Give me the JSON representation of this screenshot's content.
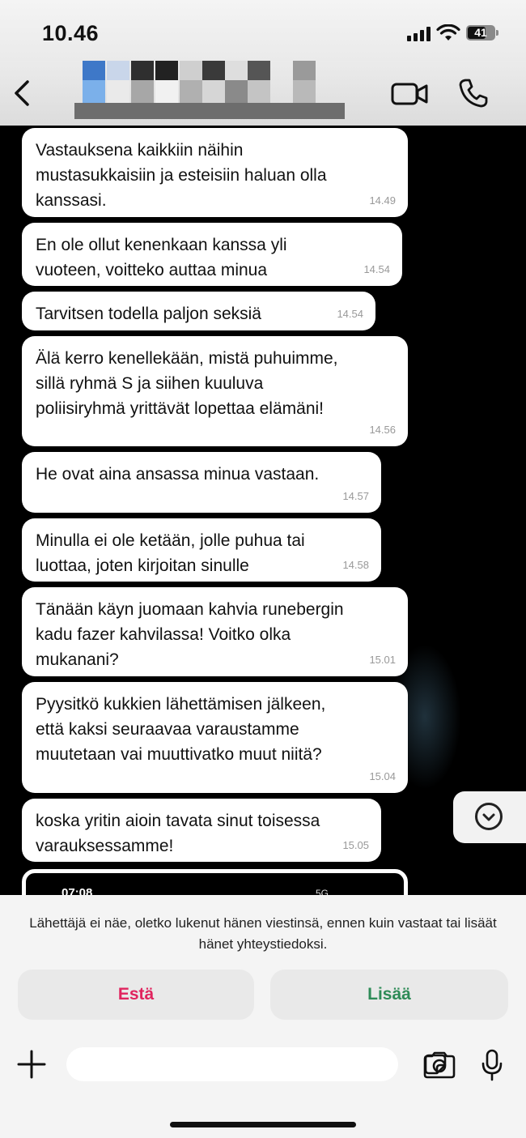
{
  "status_bar": {
    "time": "10.46",
    "battery": "41"
  },
  "header": {
    "contact_name": "",
    "icons": [
      "back-arrow-icon",
      "video-call-icon",
      "phone-icon"
    ]
  },
  "messages": [
    {
      "text": "Vastauksena kaikkiin näihin\nmustasukkaisiin ja esteisiin haluan olla\nkanssasi.",
      "time": "14.49"
    },
    {
      "text": "En ole ollut kenenkaan kanssa yli\nvuoteen, voitteko auttaa minua",
      "time": "14.54"
    },
    {
      "text": "Tarvitsen todella paljon seksiä",
      "time": "14.54"
    },
    {
      "text": "Älä kerro kenellekään, mistä puhuimme,\nsillä ryhmä S ja siihen kuuluva\npoliisiryhmä yrittävät lopettaa elämäni!",
      "time": "14.56"
    },
    {
      "text": "He ovat aina ansassa minua vastaan.",
      "time": "14.57"
    },
    {
      "text": "Minulla ei ole ketään, jolle puhua tai\nluottaa, joten kirjoitan sinulle",
      "time": "14.58"
    },
    {
      "text": "Tänään käyn juomaan kahvia runebergin\nkadu fazer kahvilassa! Voitko olka\nmukanani?",
      "time": "15.01"
    },
    {
      "text": "Pyysitkö kukkien lähettämisen jälkeen,\nettä kaksi seuraavaa varaustamme\nmuutetaan vai muuttivatko muut niitä?",
      "time": "15.04"
    },
    {
      "text": "koska yritin aioin tavata sinut toisessa\nvarauksessamme!",
      "time": "15.05"
    }
  ],
  "attachment": {
    "time": "07:08",
    "status": "5G"
  },
  "notice": "Lähettäjä ei näe, oletko lukenut hänen viestinsä, ennen kuin vastaat tai lisäät hänet yhteystiedoksi.",
  "actions": {
    "block": "Estä",
    "add": "Lisää"
  },
  "colors": {
    "block": "#e0245e",
    "add": "#2e8b57",
    "bubble": "#ffffff",
    "chat_bg": "#000000"
  }
}
